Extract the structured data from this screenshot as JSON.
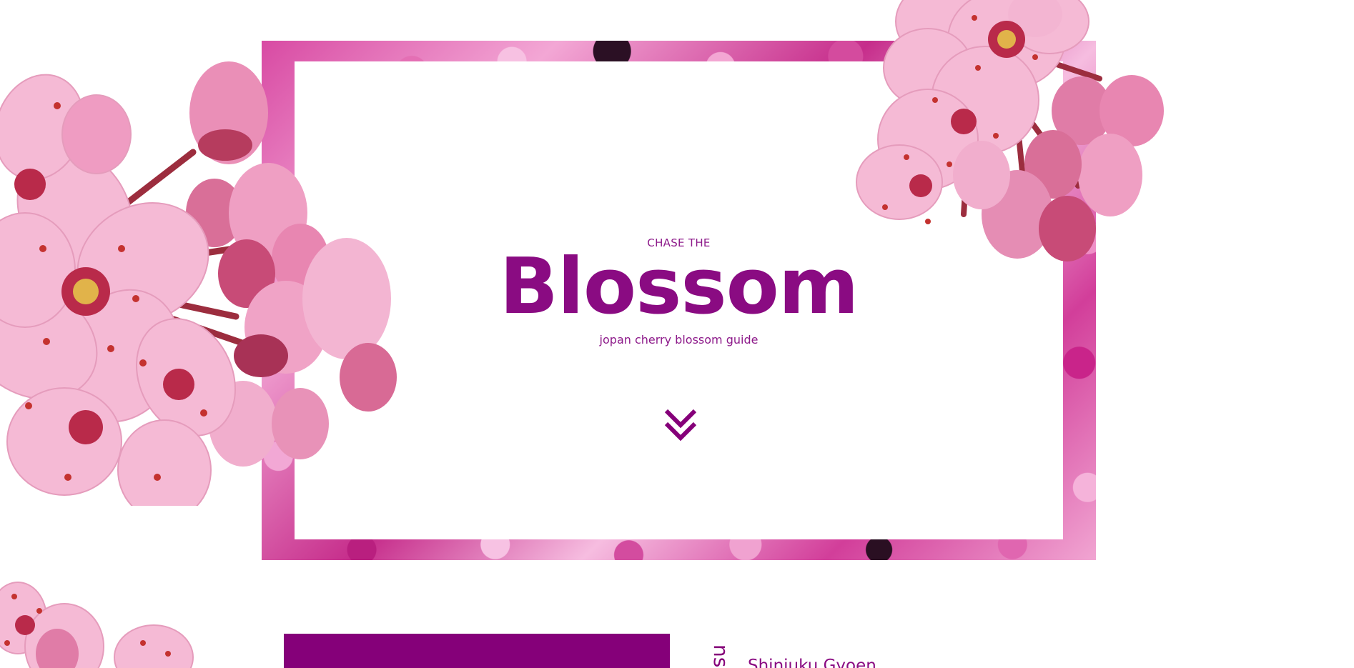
{
  "hero": {
    "eyebrow": "CHASE THE",
    "title": "Blossom",
    "subtitle": "jopan cherry blossom guide",
    "scroll_icon": "double-chevron-down-icon"
  },
  "section": {
    "vertical_heading": "ns",
    "location_title": "Shinjuku Gyoen"
  },
  "colors": {
    "brand_purple": "#850079",
    "title_purple": "#8a0b82",
    "frame_pink": "#d84aa3",
    "petal_pink": "#f4b3d2",
    "petal_deep": "#d66d9c",
    "bud_red": "#c94270",
    "stem": "#9c2d3e",
    "stamen": "#c4322f"
  }
}
